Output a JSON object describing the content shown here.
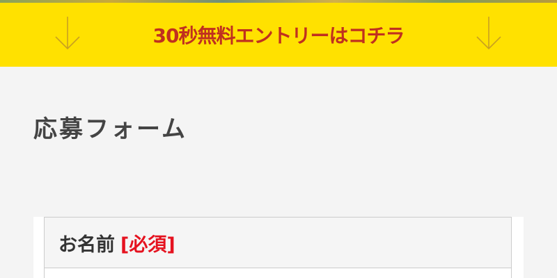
{
  "banner": {
    "text": "30秒無料エントリーはコチラ",
    "left_icon": "arrow-down-icon",
    "right_icon": "arrow-down-icon",
    "background_color": "#ffe100",
    "text_color": "#c0301f"
  },
  "form": {
    "title": "応募フォーム",
    "fields": [
      {
        "label": "お名前",
        "required_label": "[必須]",
        "required_color": "#e5121f"
      }
    ]
  }
}
